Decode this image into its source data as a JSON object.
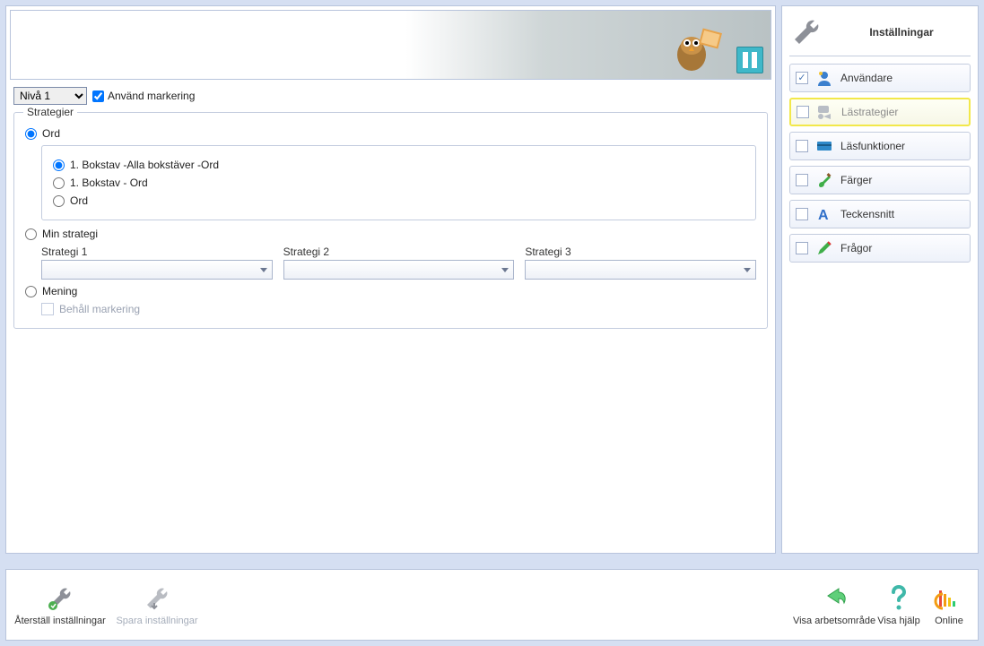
{
  "level_select": {
    "options": [
      "Nivå 1"
    ],
    "value": "Nivå 1"
  },
  "use_marking": {
    "label": "Använd markering",
    "checked": true
  },
  "strategier": {
    "legend": "Strategier",
    "ord": {
      "label": "Ord",
      "checked": true,
      "options": [
        {
          "label": "1. Bokstav -Alla bokstäver -Ord",
          "checked": true
        },
        {
          "label": "1. Bokstav - Ord",
          "checked": false
        },
        {
          "label": "Ord",
          "checked": false
        }
      ]
    },
    "min_strategi": {
      "label": "Min strategi",
      "checked": false,
      "cols": [
        {
          "label": "Strategi 1",
          "value": ""
        },
        {
          "label": "Strategi 2",
          "value": ""
        },
        {
          "label": "Strategi 3",
          "value": ""
        }
      ]
    },
    "mening": {
      "label": "Mening",
      "checked": false
    },
    "behall": {
      "label": "Behåll markering",
      "checked": false
    }
  },
  "settings_panel": {
    "title": "Inställningar",
    "items": [
      {
        "key": "anvandare",
        "label": "Användare",
        "checked": true,
        "active": false,
        "icon": "user"
      },
      {
        "key": "lastrategier",
        "label": "Lästrategier",
        "checked": false,
        "active": true,
        "icon": "strategy"
      },
      {
        "key": "lasfunktioner",
        "label": "Läsfunktioner",
        "checked": false,
        "active": false,
        "icon": "card"
      },
      {
        "key": "farger",
        "label": "Färger",
        "checked": false,
        "active": false,
        "icon": "brush"
      },
      {
        "key": "teckensnitt",
        "label": "Teckensnitt",
        "checked": false,
        "active": false,
        "icon": "font"
      },
      {
        "key": "fragor",
        "label": "Frågor",
        "checked": false,
        "active": false,
        "icon": "pen"
      }
    ]
  },
  "bottom_bar": {
    "reset": "Återställ inställningar",
    "save": "Spara inställningar",
    "workspace": "Visa arbetsområde",
    "help": "Visa hjälp",
    "online": "Online"
  }
}
